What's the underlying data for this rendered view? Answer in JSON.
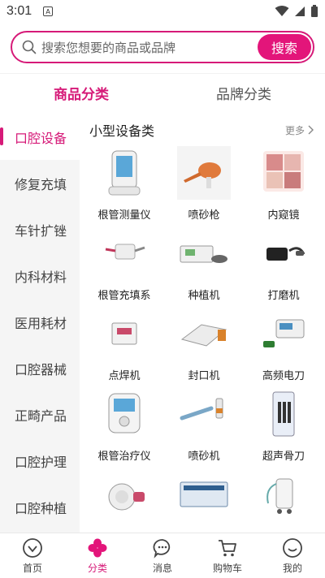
{
  "status": {
    "time": "3:01",
    "notification_glyph": "A"
  },
  "search": {
    "placeholder": "搜索您想要的商品或品牌",
    "button": "搜索"
  },
  "tabs": [
    {
      "label": "商品分类",
      "active": true
    },
    {
      "label": "品牌分类",
      "active": false
    }
  ],
  "sidebar": {
    "items": [
      {
        "label": "口腔设备",
        "active": true
      },
      {
        "label": "修复充填"
      },
      {
        "label": "车针扩锉"
      },
      {
        "label": "内科材料"
      },
      {
        "label": "医用耗材"
      },
      {
        "label": "口腔器械"
      },
      {
        "label": "正畸产品"
      },
      {
        "label": "口腔护理"
      },
      {
        "label": "口腔种植"
      }
    ]
  },
  "section": {
    "title": "小型设备类",
    "more": "更多",
    "products": [
      {
        "name": "根管测量仪",
        "icon": "apex-locator"
      },
      {
        "name": "喷砂枪",
        "icon": "sandblast-gun"
      },
      {
        "name": "内窥镜",
        "icon": "endoscope"
      },
      {
        "name": "根管充填系",
        "icon": "obturation-system"
      },
      {
        "name": "种植机",
        "icon": "implant-motor"
      },
      {
        "name": "打磨机",
        "icon": "micromotor"
      },
      {
        "name": "点焊机",
        "icon": "spot-welder"
      },
      {
        "name": "封口机",
        "icon": "sealing-machine"
      },
      {
        "name": "高频电刀",
        "icon": "electrosurgical-unit"
      },
      {
        "name": "根管治疗仪",
        "icon": "endo-motor"
      },
      {
        "name": "喷砂机",
        "icon": "sandblaster"
      },
      {
        "name": "超声骨刀",
        "icon": "piezo-surgery"
      },
      {
        "name": "",
        "icon": "lab-motor"
      },
      {
        "name": "",
        "icon": "plaster-vibrator"
      },
      {
        "name": "",
        "icon": "suction-unit"
      }
    ]
  },
  "bottom_nav": [
    {
      "label": "首页",
      "icon": "home-icon"
    },
    {
      "label": "分类",
      "icon": "category-icon",
      "active": true
    },
    {
      "label": "消息",
      "icon": "message-icon"
    },
    {
      "label": "购物车",
      "icon": "cart-icon"
    },
    {
      "label": "我的",
      "icon": "profile-icon"
    }
  ],
  "colors": {
    "accent": "#e3157a",
    "sidebar_bg": "#f5f5f5"
  }
}
